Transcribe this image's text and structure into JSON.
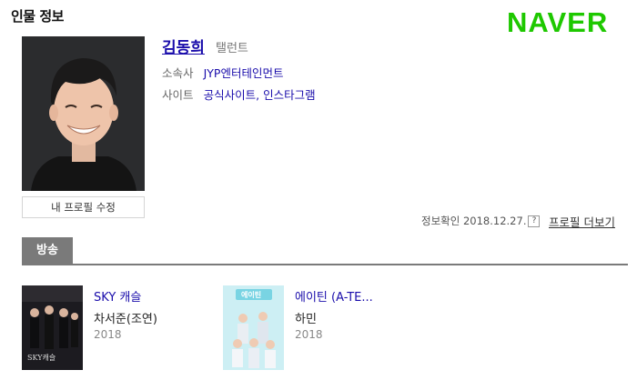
{
  "section": {
    "title": "인물 정보"
  },
  "brand": {
    "logo": "NAVER",
    "color": "#1ec800"
  },
  "person": {
    "name": "김동희",
    "role": "탤런트",
    "agency_label": "소속사",
    "agency_value": "JYP엔터테인먼트",
    "site_label": "사이트",
    "sites": [
      "공식사이트",
      "인스타그램"
    ],
    "site_separator": ", "
  },
  "actions": {
    "edit_profile": "내 프로필 수정",
    "updated_label": "정보확인 2018.12.27.",
    "help_glyph": "?",
    "more_profile": "프로필 더보기"
  },
  "tabs": [
    {
      "label": "방송",
      "active": true
    }
  ],
  "shows": [
    {
      "title": "SKY 캐슬",
      "role": "차서준(조연)",
      "year": "2018",
      "poster_text": "SKY캐슬"
    },
    {
      "title": "에이틴 (A-TE...",
      "role": "하민",
      "year": "2018",
      "poster_text": "에이틴"
    }
  ]
}
